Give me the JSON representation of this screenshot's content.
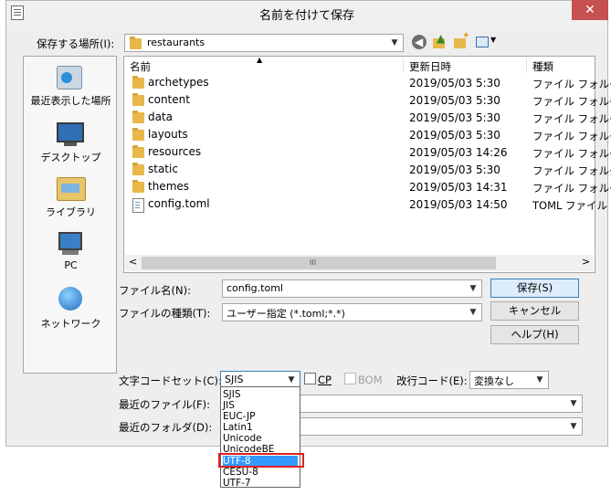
{
  "dialog": {
    "title": "名前を付けて保存",
    "close_glyph": "✕"
  },
  "location": {
    "label": "保存する場所(I):",
    "value": "restaurants"
  },
  "places": [
    {
      "label": "最近表示した場所",
      "icon": "recent-places-icon"
    },
    {
      "label": "デスクトップ",
      "icon": "desktop-icon"
    },
    {
      "label": "ライブラリ",
      "icon": "libraries-icon"
    },
    {
      "label": "PC",
      "icon": "computer-icon"
    },
    {
      "label": "ネットワーク",
      "icon": "network-icon"
    }
  ],
  "columns": {
    "name": "名前",
    "date": "更新日時",
    "type": "種類",
    "sort_glyph": "▲"
  },
  "files": [
    {
      "name": "archetypes",
      "date": "2019/05/03 5:30",
      "type": "ファイル フォルダー",
      "kind": "folder"
    },
    {
      "name": "content",
      "date": "2019/05/03 5:30",
      "type": "ファイル フォルダー",
      "kind": "folder"
    },
    {
      "name": "data",
      "date": "2019/05/03 5:30",
      "type": "ファイル フォルダー",
      "kind": "folder"
    },
    {
      "name": "layouts",
      "date": "2019/05/03 5:30",
      "type": "ファイル フォルダー",
      "kind": "folder"
    },
    {
      "name": "resources",
      "date": "2019/05/03 14:26",
      "type": "ファイル フォルダー",
      "kind": "folder"
    },
    {
      "name": "static",
      "date": "2019/05/03 5:30",
      "type": "ファイル フォルダー",
      "kind": "folder"
    },
    {
      "name": "themes",
      "date": "2019/05/03 14:31",
      "type": "ファイル フォルダー",
      "kind": "folder"
    },
    {
      "name": "config.toml",
      "date": "2019/05/03 14:50",
      "type": "TOML ファイル",
      "kind": "file"
    }
  ],
  "scroll": {
    "left_glyph": "<",
    "right_glyph": ">",
    "thumb_glyph": "III"
  },
  "filename": {
    "label": "ファイル名(N):",
    "value": "config.toml"
  },
  "filetype": {
    "label": "ファイルの種類(T):",
    "value": "ユーザー指定 (*.toml;*.*)"
  },
  "buttons": {
    "save": "保存(S)",
    "cancel": "キャンセル",
    "help": "ヘルプ(H)"
  },
  "encoding": {
    "label": "文字コードセット(C):",
    "value": "SJIS",
    "cp_label": "CP",
    "bom_label": "BOM",
    "options": [
      "SJIS",
      "JIS",
      "EUC-JP",
      "Latin1",
      "Unicode",
      "UnicodeBE",
      "UTF-8",
      "CESU-8",
      "UTF-7"
    ],
    "selected": "UTF-8"
  },
  "newline": {
    "label": "改行コード(E):",
    "value": "変換なし"
  },
  "recent_files": {
    "label": "最近のファイル(F):"
  },
  "recent_folders": {
    "label": "最近のフォルダ(D):"
  },
  "colors": {
    "selection": "#3399ff",
    "highlight_box": "#e02020"
  }
}
